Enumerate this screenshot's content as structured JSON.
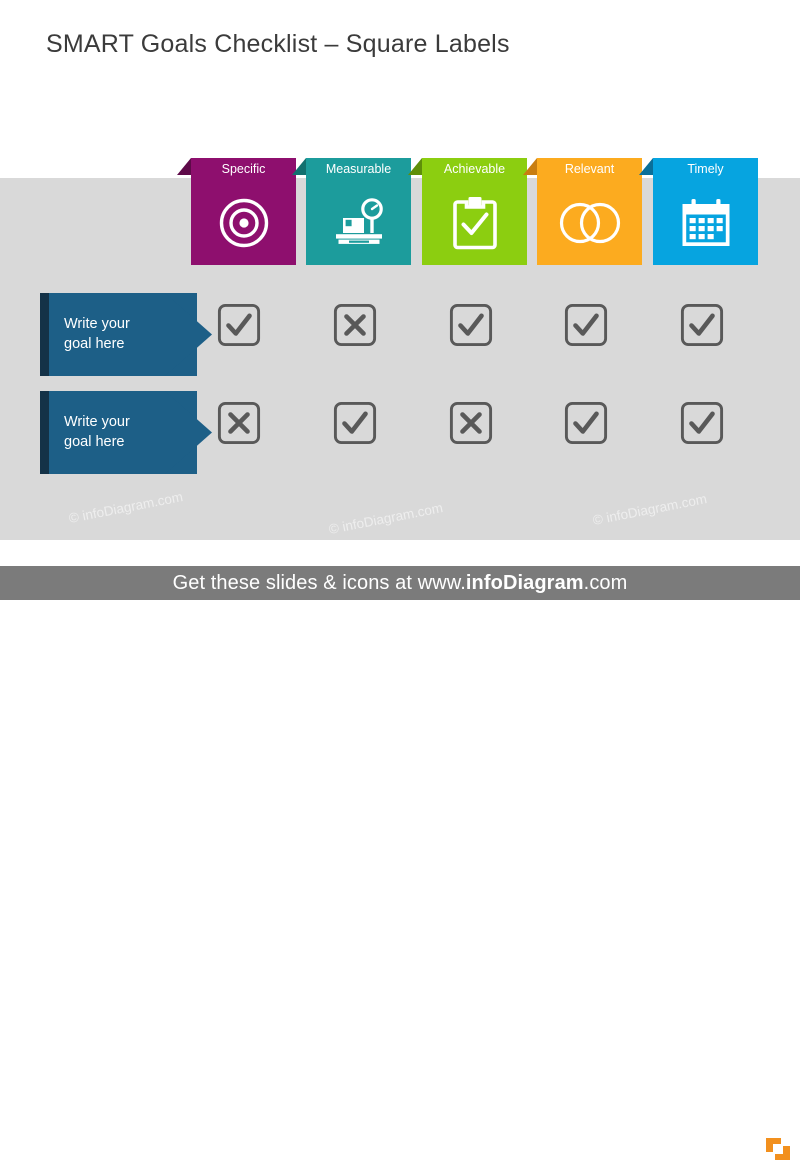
{
  "slide": {
    "title": "SMART Goals Checklist – Square Labels",
    "background_color": "#ffffff",
    "panel_color": "#d9d9d9"
  },
  "columns": [
    {
      "label": "Specific",
      "color": "#8e0f6e",
      "fold_color": "#5e0a49",
      "icon": "target-icon"
    },
    {
      "label": "Measurable",
      "color": "#1c9c9c",
      "fold_color": "#12706f",
      "icon": "weighing-scale-icon"
    },
    {
      "label": "Achievable",
      "color": "#8cce10",
      "fold_color": "#5f8f09",
      "icon": "clipboard-check-icon"
    },
    {
      "label": "Relevant",
      "color": "#fcab1f",
      "fold_color": "#c87d11",
      "icon": "venn-circles-icon"
    },
    {
      "label": "Timely",
      "color": "#06a4e0",
      "fold_color": "#0a6f99",
      "icon": "calendar-icon"
    }
  ],
  "rows": [
    {
      "label": "Write your goal here",
      "label_line1": "Write your",
      "label_line2": "goal here",
      "fill_color": "#1d5f87",
      "edge_color": "#143247",
      "marks": [
        "check",
        "cross",
        "check",
        "check",
        "check"
      ]
    },
    {
      "label": "Write your goal here",
      "label_line1": "Write your",
      "label_line2": "goal here",
      "fill_color": "#1d5f87",
      "edge_color": "#143247",
      "marks": [
        "cross",
        "check",
        "cross",
        "check",
        "check"
      ]
    }
  ],
  "checkbox": {
    "stroke_color": "#595959",
    "check_glyph": "check-mark",
    "cross_glyph": "cross-mark"
  },
  "watermarks": [
    {
      "text": "© infoDiagram.com"
    },
    {
      "text": "© infoDiagram.com"
    },
    {
      "text": "© infoDiagram.com"
    }
  ],
  "footer": {
    "text_before": "Get these slides & icons at www.",
    "text_bold": "infoDiagram",
    "text_after": ".com",
    "background_color": "#7b7b7b",
    "logo_color": "#f2901e"
  }
}
